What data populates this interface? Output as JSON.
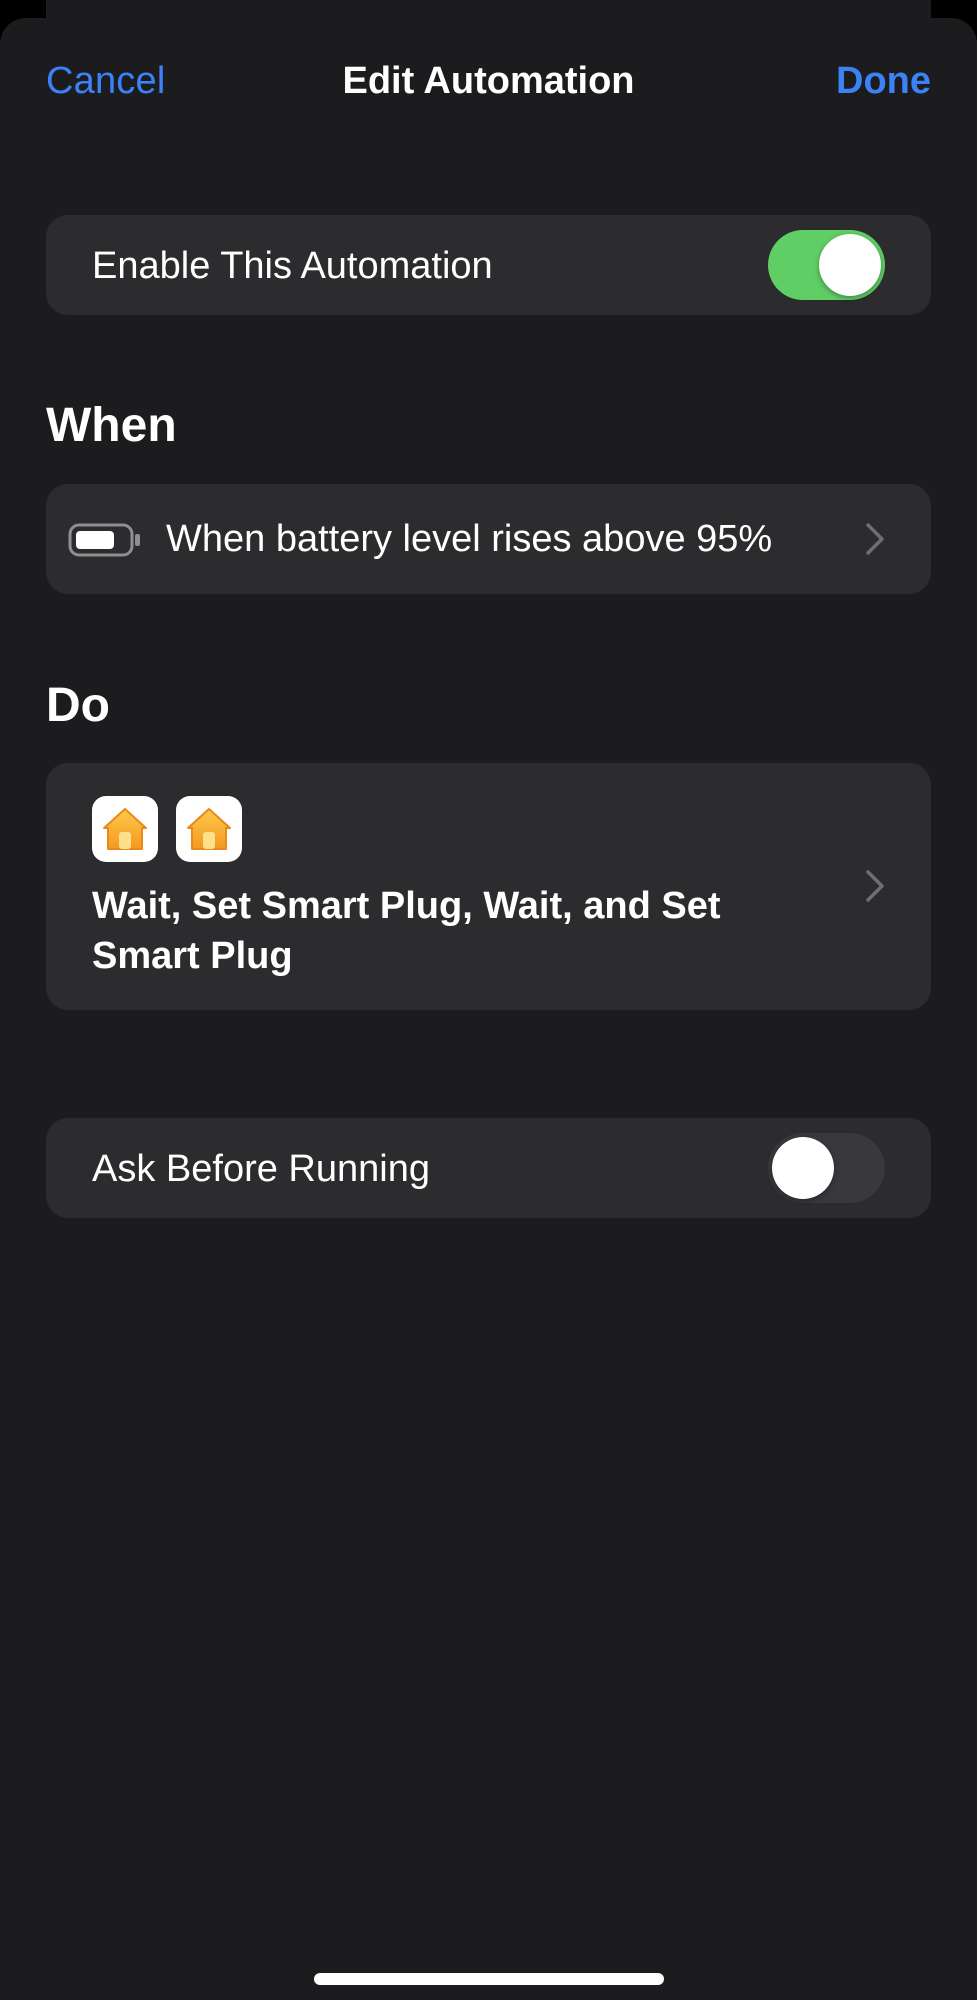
{
  "nav": {
    "cancel_label": "Cancel",
    "title": "Edit Automation",
    "done_label": "Done"
  },
  "enable": {
    "label": "Enable This Automation",
    "on": true
  },
  "when": {
    "section_title": "When",
    "trigger_text": "When battery level rises above 95%",
    "icon": "battery-icon"
  },
  "do": {
    "section_title": "Do",
    "icons": [
      "home-app-icon",
      "home-app-icon"
    ],
    "actions_text": "Wait, Set Smart Plug, Wait, and Set Smart Plug"
  },
  "ask": {
    "label": "Ask Before Running",
    "on": false
  },
  "colors": {
    "accent": "#3b82f6",
    "toggle_on": "#5fcf65",
    "card": "#2c2c2e",
    "background": "#1c1c1e"
  }
}
